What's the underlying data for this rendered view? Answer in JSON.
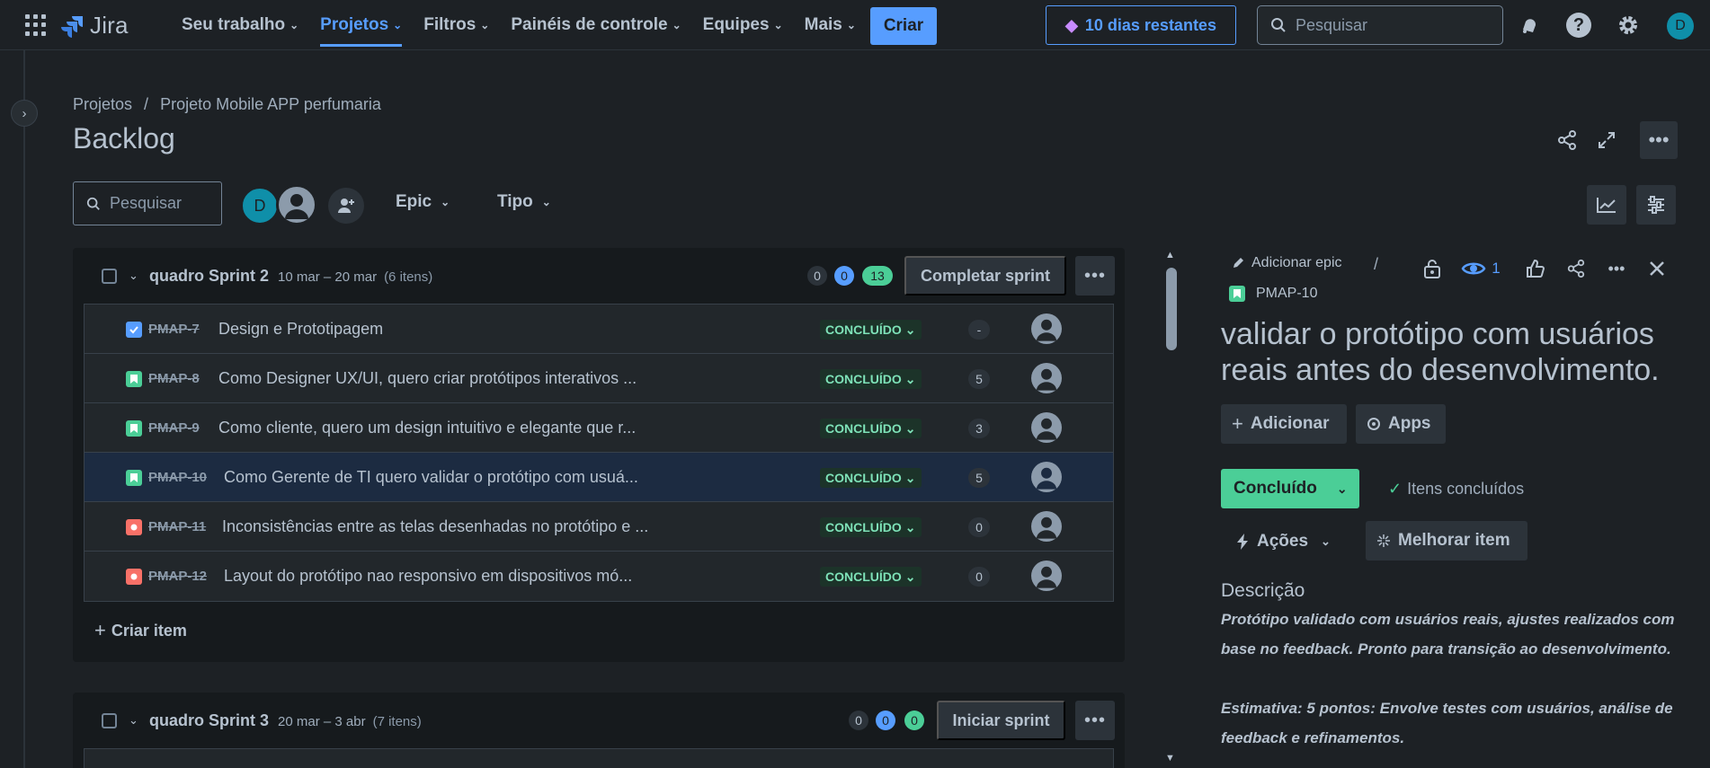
{
  "nav": {
    "app_name": "Jira",
    "items": [
      {
        "label": "Seu trabalho",
        "active": false
      },
      {
        "label": "Projetos",
        "active": true
      },
      {
        "label": "Filtros",
        "active": false
      },
      {
        "label": "Painéis de controle",
        "active": false
      },
      {
        "label": "Equipes",
        "active": false
      },
      {
        "label": "Mais",
        "active": false
      }
    ],
    "create_label": "Criar",
    "trial_label": "10 dias restantes",
    "search_placeholder": "Pesquisar",
    "user_initial": "D"
  },
  "header": {
    "breadcrumb": [
      "Projetos",
      "/",
      "Projeto Mobile APP perfumaria"
    ],
    "title": "Backlog"
  },
  "filters": {
    "search_placeholder": "Pesquisar",
    "avatar_initial": "D",
    "epic_label": "Epic",
    "type_label": "Tipo"
  },
  "sprints": [
    {
      "name": "quadro Sprint 2",
      "dates": "10 mar – 20 mar",
      "count": "(6 itens)",
      "todo": "0",
      "in_progress": "0",
      "done": "13",
      "action_label": "Completar sprint",
      "issues": [
        {
          "key": "PMAP-7",
          "type": "task",
          "summary": "Design e Prototipagem",
          "status": "CONCLUÍDO",
          "points": "-"
        },
        {
          "key": "PMAP-8",
          "type": "story",
          "summary": "Como Designer UX/UI, quero criar protótipos interativos ...",
          "status": "CONCLUÍDO",
          "points": "5"
        },
        {
          "key": "PMAP-9",
          "type": "story",
          "summary": "Como cliente, quero um design intuitivo e elegante que r...",
          "status": "CONCLUÍDO",
          "points": "3"
        },
        {
          "key": "PMAP-10",
          "type": "story",
          "summary": "Como Gerente de TI quero validar o protótipo com usuá...",
          "status": "CONCLUÍDO",
          "points": "5"
        },
        {
          "key": "PMAP-11",
          "type": "bug",
          "summary": "Inconsistências entre as telas desenhadas no protótipo e ...",
          "status": "CONCLUÍDO",
          "points": "0"
        },
        {
          "key": "PMAP-12",
          "type": "bug",
          "summary": "Layout do protótipo nao responsivo em dispositivos mó...",
          "status": "CONCLUÍDO",
          "points": "0"
        }
      ],
      "create_label": "Criar item"
    },
    {
      "name": "quadro Sprint 3",
      "dates": "20 mar – 3 abr",
      "count": "(7 itens)",
      "todo": "0",
      "in_progress": "0",
      "done": "0",
      "action_label": "Iniciar sprint"
    }
  ],
  "detail": {
    "add_epic_label": "Adicionar epic",
    "separator": "/",
    "issue_key": "PMAP-10",
    "watchers": "1",
    "title": "validar o protótipo com usuários reais antes do desenvolvimento.",
    "add_label": "Adicionar",
    "apps_label": "Apps",
    "status_label": "Concluído",
    "done_label": "Itens concluídos",
    "actions_label": "Ações",
    "improve_label": "Melhorar item",
    "description_heading": "Descrição",
    "description_p1": "Protótipo validado com usuários reais, ajustes realizados com base no feedback. Pronto para transição ao desenvolvimento.",
    "description_p2": "Estimativa: 5 pontos:  Envolve testes com usuários, análise de feedback e refinamentos."
  },
  "colors": {
    "background": "#1d2125",
    "accent": "#579dff",
    "done_green": "#4bce97",
    "selected_row": "#1c2b41"
  }
}
